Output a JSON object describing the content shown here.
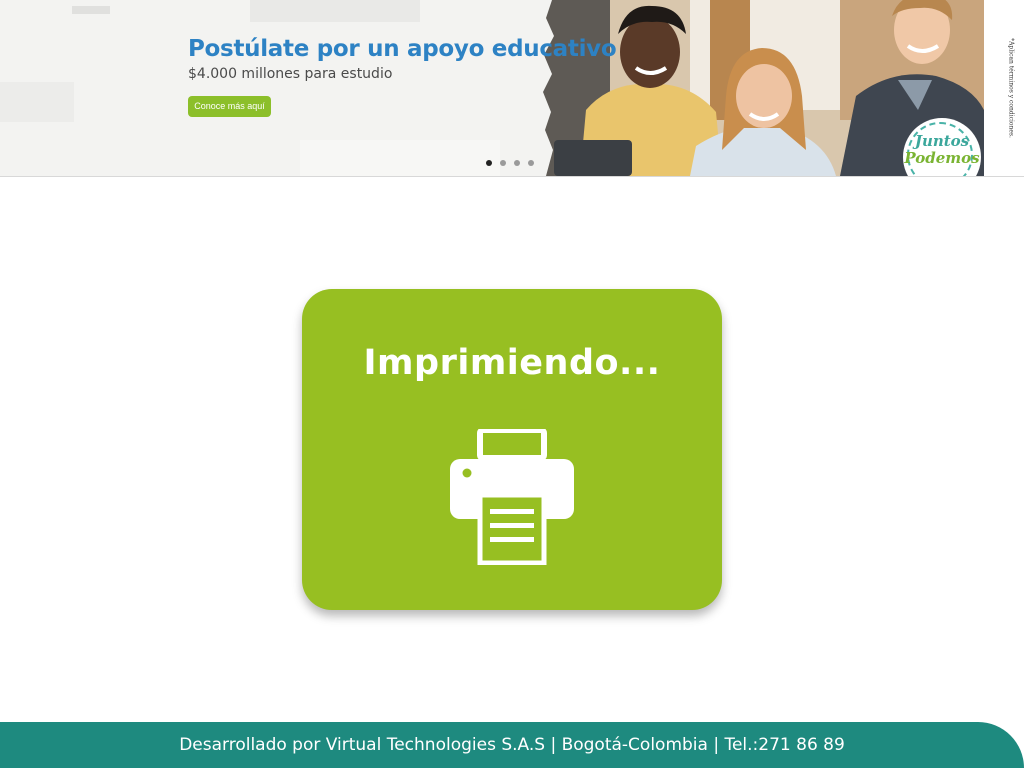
{
  "banner": {
    "title": "Postúlate por un apoyo educativo",
    "subtitle": "$4.000 millones para estudio",
    "cta_label": "Conoce más aquí",
    "terms_note": "*Aplican términos y condiciones.",
    "badge_line1": "Juntos",
    "badge_line2": "Podemos",
    "carousel": {
      "slide_count": 4,
      "active_slide": 1
    },
    "title_color": "#2d82c4",
    "cta_color": "#8cbf2a"
  },
  "printing": {
    "status_text": "Imprimiendo...",
    "icon": "printer-icon",
    "card_color": "#97bf22"
  },
  "footer": {
    "text": "Desarrollado por Virtual Technologies S.A.S  |  Bogotá-Colombia  |  Tel.:271 86 89",
    "color": "#1e8a7f"
  }
}
